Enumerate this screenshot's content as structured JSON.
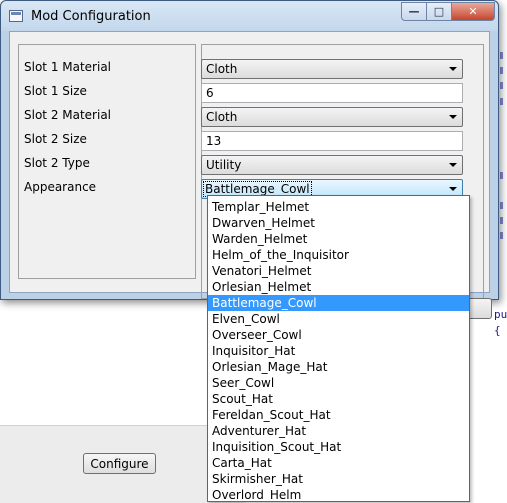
{
  "window": {
    "title": "Mod Configuration"
  },
  "form": {
    "fields": [
      {
        "label": "Slot 1 Material",
        "kind": "combo",
        "value": "Cloth"
      },
      {
        "label": "Slot 1 Size",
        "kind": "text",
        "value": "6"
      },
      {
        "label": "Slot 2 Material",
        "kind": "combo",
        "value": "Cloth"
      },
      {
        "label": "Slot 2 Size",
        "kind": "text",
        "value": "13"
      },
      {
        "label": "Slot 2 Type",
        "kind": "combo",
        "value": "Utility"
      },
      {
        "label": "Appearance",
        "kind": "combo",
        "value": "Battlemage_Cowl"
      }
    ]
  },
  "dropdown": {
    "selected": "Battlemage_Cowl",
    "options": [
      "Templar_Helmet",
      "Dwarven_Helmet",
      "Warden_Helmet",
      "Helm_of_the_Inquisitor",
      "Venatori_Helmet",
      "Orlesian_Helmet",
      "Battlemage_Cowl",
      "Elven_Cowl",
      "Overseer_Cowl",
      "Inquisitor_Hat",
      "Orlesian_Mage_Hat",
      "Seer_Cowl",
      "Scout_Hat",
      "Fereldan_Scout_Hat",
      "Adventurer_Hat",
      "Inquisition_Scout_Hat",
      "Carta_Hat",
      "Skirmisher_Hat",
      "Overlord_Helm"
    ]
  },
  "background": {
    "configure_label": "Configure",
    "code": [
      "pu",
      "{"
    ]
  },
  "colors": {
    "selection": "#3399ff",
    "titlebar": "#c3d7ec",
    "close": "#c7452c"
  }
}
